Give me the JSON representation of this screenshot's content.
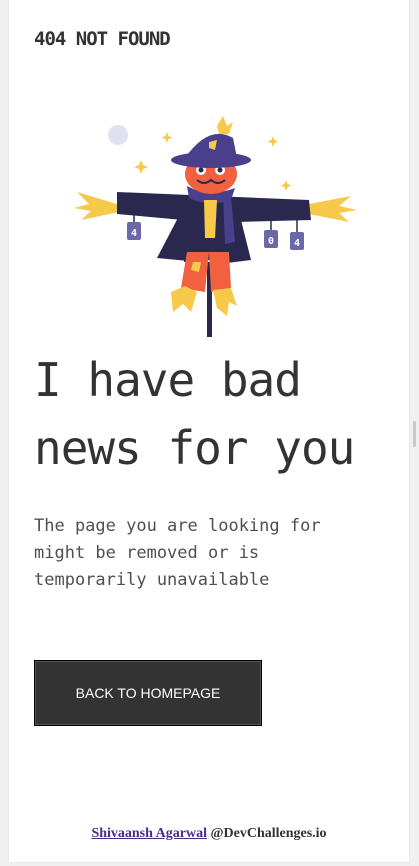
{
  "header": {
    "brand": "404 NOT FOUND"
  },
  "illustration": {
    "tag_left": "4",
    "tag_mid": "0",
    "tag_right": "4",
    "colors": {
      "hat": "#4a3f8a",
      "coat": "#2b2850",
      "face": "#f2613f",
      "straw": "#f7c94a",
      "tags": "#6b68a8"
    }
  },
  "main": {
    "headline": "I have bad news for you",
    "description": "The page you are looking for might be removed or is temporarily unavailable",
    "button_label": "BACK TO HOMEPAGE"
  },
  "footer": {
    "author": "Shivaansh Agarwal",
    "suffix": " @DevChallenges.io"
  }
}
